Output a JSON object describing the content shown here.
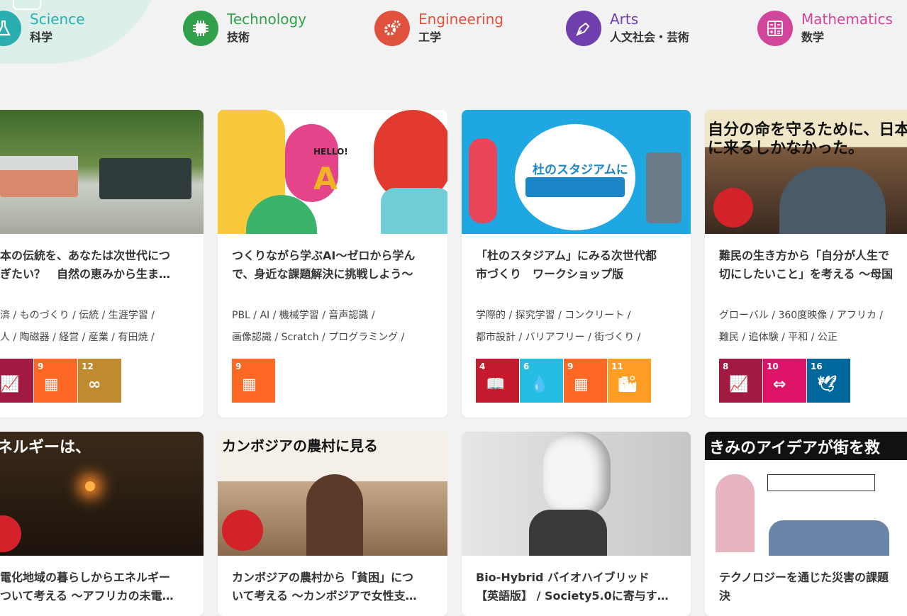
{
  "categories": [
    {
      "en": "Science",
      "jp": "科学",
      "color": "#2aaeb0",
      "icon": "flask-icon"
    },
    {
      "en": "Technology",
      "jp": "技術",
      "color": "#30a04b",
      "icon": "chip-icon"
    },
    {
      "en": "Engineering",
      "jp": "工学",
      "color": "#e0523f",
      "icon": "gears-icon"
    },
    {
      "en": "Arts",
      "jp": "人文社会・芸術",
      "color": "#6f3fae",
      "icon": "pen-nib-icon"
    },
    {
      "en": "Mathematics",
      "jp": "数学",
      "color": "#d1459a",
      "icon": "calculator-icon"
    }
  ],
  "cards": [
    {
      "title": [
        "本の伝統を、あなたは次世代につ",
        "ぎたい？　自然の恵みから生ま…"
      ],
      "tags": [
        "済 / ものづくり / 伝統 / 生涯学習 /",
        "人 / 陶磁器 / 経営 / 産業 / 有田焼 /"
      ],
      "sdgs": [
        {
          "n": "8",
          "color": "#a21942",
          "icon": "chart-icon"
        },
        {
          "n": "9",
          "color": "#fd6925",
          "icon": "cubes-icon"
        },
        {
          "n": "12",
          "color": "#bf8b2e",
          "icon": "infinity-icon"
        }
      ],
      "thumb": "pottery"
    },
    {
      "title": [
        "つくりながら学ぶAI〜ゼロから学ん",
        "で、身近な課題解決に挑戦しよう〜"
      ],
      "tags": [
        "PBL / AI / 機械学習 / 音声認識 /",
        "画像認識 / Scratch / プログラミング /"
      ],
      "sdgs": [
        {
          "n": "9",
          "color": "#fd6925",
          "icon": "cubes-icon"
        }
      ],
      "thumb": "ai",
      "thumb_text": "HELLO!"
    },
    {
      "title": [
        "「杜のスタジアム」にみる次世代都",
        "市づくり　ワークショップ版"
      ],
      "tags": [
        "学際的 / 探究学習 / コンクリート /",
        "都市設計 / バリアフリー / 街づくり /"
      ],
      "sdgs": [
        {
          "n": "4",
          "color": "#c5192d",
          "icon": "book-icon"
        },
        {
          "n": "6",
          "color": "#26bde2",
          "icon": "drop-icon"
        },
        {
          "n": "9",
          "color": "#fd6925",
          "icon": "cubes-icon"
        },
        {
          "n": "11",
          "color": "#fd9d24",
          "icon": "city-icon"
        }
      ],
      "thumb": "stadium",
      "thumb_text": "杜のスタジアムに"
    },
    {
      "title": [
        "難民の生き方から「自分が人生で",
        "切にしたいこと」を考える 〜母国"
      ],
      "tags": [
        "グローバル / 360度映像 / アフリカ /",
        "難民 / 追体験 / 平和 / 公正"
      ],
      "sdgs": [
        {
          "n": "8",
          "color": "#a21942",
          "icon": "chart-icon"
        },
        {
          "n": "10",
          "color": "#dd1367",
          "icon": "arrows-icon"
        },
        {
          "n": "16",
          "color": "#00689d",
          "icon": "dove-icon"
        }
      ],
      "thumb": "refugee",
      "thumb_text": "自分の命を守るために、日本に来るしかなかった。"
    },
    {
      "title": [
        "電化地域の暮らしからエネルギー",
        "ついて考える 〜アフリカの未電…"
      ],
      "thumb": "energy",
      "thumb_text": "ネルギーは、"
    },
    {
      "title": [
        "カンボジアの農村から「貧困」につ",
        "いて考える 〜カンボジアで女性支…"
      ],
      "thumb": "cambodia",
      "thumb_text": "カンボジアの農村に見る"
    },
    {
      "title": [
        "Bio-Hybrid バイオハイブリッド",
        "【英語版】 / Society5.0に寄与す…"
      ],
      "thumb": "robot"
    },
    {
      "title": [
        "テクノロジーを通じた災害の課題",
        "決"
      ],
      "thumb": "idea",
      "thumb_text": "きみのアイデアが街を救"
    }
  ]
}
